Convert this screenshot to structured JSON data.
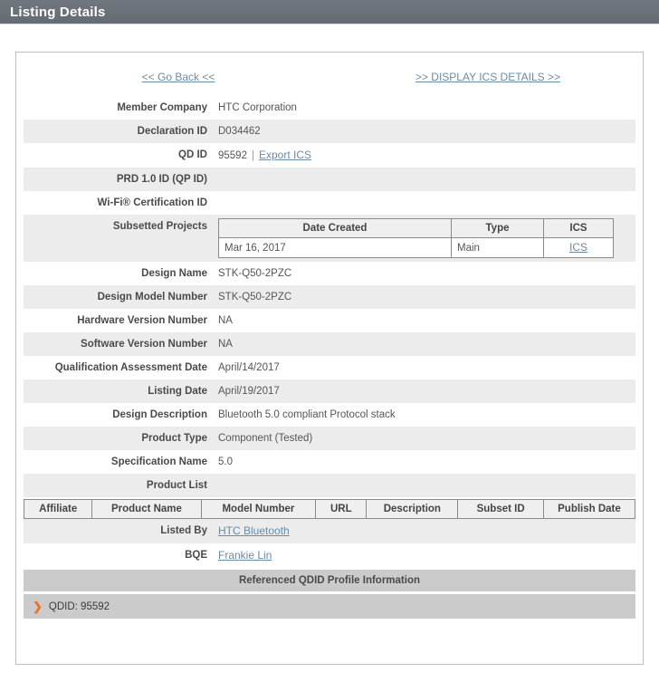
{
  "header": {
    "title": "Listing Details"
  },
  "nav": {
    "back_label": "<< Go Back <<",
    "ics_details_label": ">> DISPLAY ICS DETAILS >>"
  },
  "details": [
    {
      "label": "Member Company",
      "value": "HTC Corporation"
    },
    {
      "label": "Declaration ID",
      "value": "D034462"
    },
    {
      "label": "QD ID",
      "value": "95592",
      "separator": "|",
      "link": "Export ICS"
    },
    {
      "label": "PRD 1.0 ID (QP ID)",
      "value": ""
    },
    {
      "label": "Wi-Fi® Certification ID",
      "value": ""
    },
    {
      "label": "Subsetted Projects",
      "value": ""
    },
    {
      "label": "Design Name",
      "value": "STK-Q50-2PZC"
    },
    {
      "label": "Design Model Number",
      "value": "STK-Q50-2PZC"
    },
    {
      "label": "Hardware Version Number",
      "value": "NA"
    },
    {
      "label": "Software Version Number",
      "value": "NA"
    },
    {
      "label": "Qualification Assessment Date",
      "value": "April/14/2017"
    },
    {
      "label": "Listing Date",
      "value": "April/19/2017"
    },
    {
      "label": "Design Description",
      "value": "Bluetooth 5.0 compliant Protocol stack"
    },
    {
      "label": "Product Type",
      "value": "Component (Tested)"
    },
    {
      "label": "Specification Name",
      "value": "5.0"
    },
    {
      "label": "Product List",
      "value": ""
    },
    {
      "label": "Listed By",
      "link": "HTC Bluetooth"
    },
    {
      "label": "BQE",
      "link": "Frankie Lin"
    }
  ],
  "subsetted_projects": {
    "columns": [
      "Date Created",
      "Type",
      "ICS"
    ],
    "rows": [
      {
        "date_created": "Mar 16, 2017",
        "type": "Main",
        "ics": "ICS"
      }
    ]
  },
  "product_list": {
    "columns": [
      "Affiliate",
      "Product Name",
      "Model Number",
      "URL",
      "Description",
      "Subset ID",
      "Publish Date"
    ],
    "rows": []
  },
  "referenced_qdid": {
    "section_title": "Referenced QDID Profile Information",
    "entry_label": "QDID: 95592",
    "chevron": "❯"
  },
  "colors": {
    "header_bar": "#6b7280",
    "link": "#6b8ba4",
    "row_alt": "#ececec",
    "qdid_band": "#cbcbcb",
    "chevron_accent": "#e8732a"
  }
}
